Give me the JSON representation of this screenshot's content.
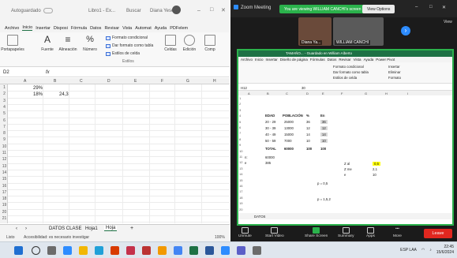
{
  "left_excel": {
    "title": "Autoguardado",
    "file": "Libro1 - Ex...",
    "search": "Buscar",
    "user": "Diana Yesen",
    "tabs": [
      "Archivo",
      "Inicio",
      "Insertar",
      "Disposi",
      "Fórmula",
      "Datos",
      "Revisar",
      "Vista",
      "Automat",
      "Ayuda",
      "PDFelem"
    ],
    "ribbon": {
      "paste": "Portapapeles",
      "font": "Fuente",
      "align": "Alineación",
      "number": "Número",
      "cond_format": "Formato condicional",
      "table_format": "Dar formato como tabla",
      "cell_styles": "Estilos de celda",
      "styles": "Estilos",
      "cells": "Celdas",
      "edit": "Edición",
      "comp": "Comp"
    },
    "namebox": "D2",
    "fx": "fx",
    "columns": [
      "A",
      "B",
      "C",
      "D",
      "E",
      "F",
      "G",
      "H"
    ],
    "rows": [
      "1",
      "2",
      "3",
      "4",
      "5",
      "6",
      "7",
      "8",
      "9",
      "10",
      "11",
      "12",
      "13",
      "14",
      "15",
      "16",
      "17",
      "18",
      "19",
      "20",
      "21"
    ],
    "cells": {
      "A1": "29%",
      "A2": "18%",
      "B2": "24,3"
    },
    "sheets": [
      "DATOS CLASE",
      "Hoja1",
      "Hoja"
    ],
    "status_left": "Listo",
    "status_accessibility": "Accesibilidad: es necesario investigar",
    "zoom": "100%"
  },
  "zoom": {
    "title": "Zoom Meeting",
    "viewing": "You are viewing WILLIAM CANCHI's screen",
    "view_options": "View Options",
    "view_button": "View",
    "participants": [
      {
        "name": "Diana Ya..."
      },
      {
        "name": "WILLIAM CANCHI"
      }
    ],
    "shared": {
      "title": "TAMAÑO... - Guardado en William Alberto",
      "tabs": [
        "Archivo",
        "Inicio",
        "Insertar",
        "Diseño de página",
        "Fórmulas",
        "Datos",
        "Revisar",
        "Vista",
        "Ayuda",
        "Power Pivot"
      ],
      "namebox": "H12",
      "formula": "30",
      "ribbon": {
        "cond_format": "Formato condicional",
        "table_format": "Dar formato como tabla",
        "cell_styles": "Estilos de celda",
        "insert": "Insertar",
        "delete": "Eliminar",
        "format": "Formato"
      },
      "columns": [
        "A",
        "B",
        "C",
        "D",
        "E",
        "F",
        "G",
        "H",
        "I"
      ],
      "table_header": [
        "EDAD",
        "POBLACIÓN",
        "%",
        "En"
      ],
      "table_rows": [
        [
          "20 - 29",
          "25000",
          "36",
          "36"
        ],
        [
          "30 - 39",
          "13000",
          "12",
          "12"
        ],
        [
          "40 - 49",
          "15000",
          "14",
          "14"
        ],
        [
          "50 - 59",
          "7000",
          "10",
          "10"
        ]
      ],
      "total": [
        "TOTAL",
        "60000",
        "100",
        "100"
      ],
      "n_label": "n:",
      "n_value": "60000",
      "e_label": "e",
      "e_value": "385",
      "side": [
        {
          "label": "Z al",
          "value": "0,5"
        },
        {
          "label": "Z me",
          "value": "2,1"
        },
        {
          "label": "e",
          "value": "10"
        }
      ],
      "extra": [
        "p = 0,5",
        "p = 1,5,2"
      ],
      "sheet_tab": "DATOS"
    },
    "controls": [
      "Unmute",
      "Start Video",
      "Share Screen",
      "Summary",
      "Apps",
      "More"
    ],
    "leave": "Leave"
  },
  "taskbar": {
    "lang": "ESP LAA",
    "time": "22:45",
    "date": "15/6/2024"
  },
  "colors": {
    "excel_green": "#1e7145",
    "zoom_green": "#2bb24c",
    "leave_red": "#e0271f",
    "highlight_yellow": "#ffff00"
  }
}
